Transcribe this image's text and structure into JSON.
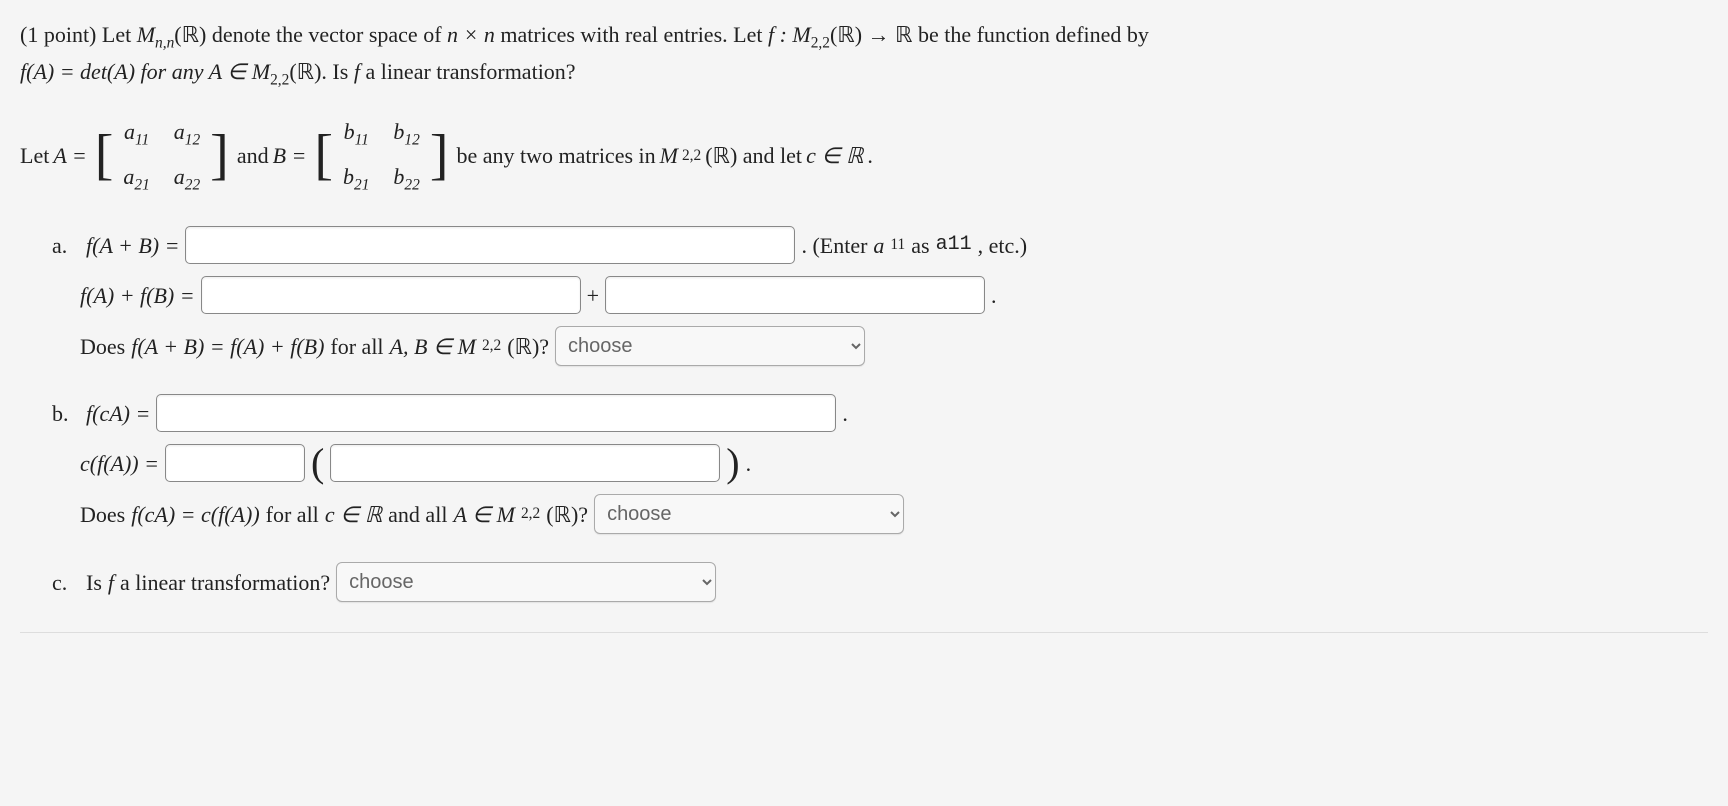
{
  "intro": {
    "points": "(1 point) Let ",
    "mnn": "M",
    "mnn_sub": "n,n",
    "r_after_mnn": "(ℝ) denote the vector space of ",
    "nxn": "n × n",
    "matrices_text": " matrices with real entries. Let ",
    "f_def": "f : M",
    "f_sub": "2,2",
    "f_codomain": "(ℝ) → ℝ be the function defined by",
    "line2_a": "f(A) = det(A) for any ",
    "line2_b": "A ∈ M",
    "line2_sub": "2,2",
    "line2_c": "(ℝ). Is ",
    "line2_d": "f",
    "line2_e": " a linear transformation?"
  },
  "setup": {
    "letA": "Let ",
    "A_eq": "A = ",
    "andB": " and ",
    "B_eq": "B = ",
    "after": " be any two matrices in ",
    "M22": "M",
    "M22_sub": "2,2",
    "M22_after": "(ℝ) and let ",
    "c_in_R": "c ∈ ℝ",
    "period": "."
  },
  "matrixA": {
    "c11": "a",
    "s11": "11",
    "c12": "a",
    "s12": "12",
    "c21": "a",
    "s21": "21",
    "c22": "a",
    "s22": "22"
  },
  "matrixB": {
    "c11": "b",
    "s11": "11",
    "c12": "b",
    "s12": "12",
    "c21": "b",
    "s21": "21",
    "c22": "b",
    "s22": "22"
  },
  "partA": {
    "label": "a.",
    "fab": "f(A + B) = ",
    "hint1": ". (Enter ",
    "hint2": "a",
    "hint2_sub": "11",
    "hint3": " as ",
    "hint4": "a11",
    "hint5": ", etc.)",
    "fAfB": "f(A) + f(B) = ",
    "plus": "+",
    "period": ".",
    "does": "Does ",
    "does_eq": "f(A + B) = f(A) + f(B)",
    "does_for": " for all ",
    "does_ab": "A, B ∈ M",
    "does_sub": "2,2",
    "does_r": "(ℝ)?",
    "choose": "choose"
  },
  "partB": {
    "label": "b.",
    "fca": "f(cA) = ",
    "period": ".",
    "cfa": "c(f(A)) = ",
    "lparen": "(",
    "rparen": ")",
    "rperiod": ".",
    "does": "Does ",
    "does_eq": "f(cA) = c(f(A))",
    "does_for": " for all ",
    "does_c": "c ∈ ℝ",
    "does_and": " and all ",
    "does_a": "A ∈ M",
    "does_sub": "2,2",
    "does_r": "(ℝ)?",
    "choose": "choose"
  },
  "partC": {
    "label": "c.",
    "question": "Is ",
    "f": "f",
    "rest": " a linear transformation?",
    "choose": "choose"
  }
}
